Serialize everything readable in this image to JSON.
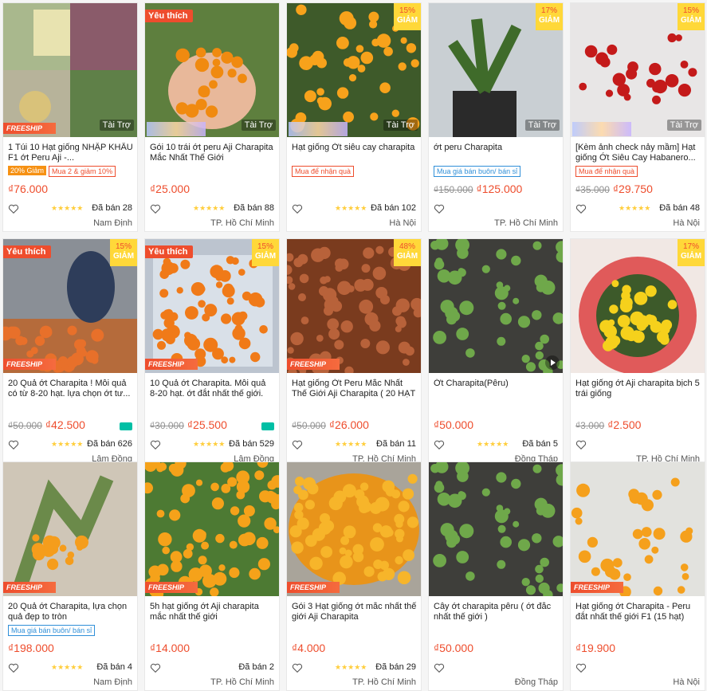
{
  "currency_symbol": "₫",
  "products": [
    {
      "title": "1 Túi 10 Hạt giống NHẬP KHẨU F1 ớt Peru Aji -...",
      "old_price": "",
      "price": "76.000",
      "sold": "Đã bán 28",
      "location": "Nam Định",
      "favorite_label": "",
      "discount": "",
      "freeship": "FREESHIP",
      "ad_label": "Tài Trợ",
      "tags": [
        {
          "type": "disc",
          "text": "20% Giảm"
        },
        {
          "type": "combo",
          "text": "Mua 2 & giảm 10%"
        }
      ],
      "stars": "★★★★★",
      "video": false,
      "photo": "collage"
    },
    {
      "title": "Gói 10 trái ớt peru Aji Charapita Mắc Nhất Thế Giới",
      "old_price": "",
      "price": "25.000",
      "sold": "Đã bán 88",
      "location": "TP. Hồ Chí Minh",
      "favorite_label": "Yêu thích",
      "discount": "",
      "freeship": "",
      "ad_label": "Tài Trợ",
      "tags": [],
      "stars": "★★★★★",
      "video": false,
      "photo": "hand"
    },
    {
      "title": "Hạt giống Ớt siêu cay charapita",
      "old_price": "",
      "price": "",
      "sold": "Đã bán 102",
      "location": "Hà Nội",
      "favorite_label": "",
      "discount": "15%",
      "freeship": "",
      "ad_label": "Tài Trợ",
      "tags": [
        {
          "type": "gift",
          "text": "Mua để nhận quà"
        }
      ],
      "stars": "★★★★★",
      "video": false,
      "photo": "orange"
    },
    {
      "title": "ớt peru Charapita",
      "old_price": "₫150.000",
      "price": "125.000",
      "sold": "",
      "location": "TP. Hồ Chí Minh",
      "favorite_label": "",
      "discount": "17%",
      "freeship": "",
      "ad_label": "Tài Trợ",
      "tags": [
        {
          "type": "whole",
          "text": "Mua giá bán buôn/ bán sỉ"
        }
      ],
      "stars": "",
      "video": false,
      "photo": "plant"
    },
    {
      "title": "[Kèm ảnh check nảy mầm] Hạt giống Ớt Siêu Cay Habanero...",
      "old_price": "₫35.000",
      "price": "29.750",
      "sold": "Đã bán 48",
      "location": "Hà Nội",
      "favorite_label": "",
      "discount": "15%",
      "freeship": "",
      "ad_label": "Tài Trợ",
      "tags": [
        {
          "type": "gift",
          "text": "Mua để nhận quà"
        }
      ],
      "stars": "★★★★★",
      "video": false,
      "photo": "red"
    },
    {
      "title": "20 Quả ớt Charapita ! Mỗi quả có từ 8-20 hạt. lựa chọn ớt tư...",
      "old_price": "₫50.000",
      "price": "42.500",
      "sold": "Đã bán 626",
      "location": "Lâm Đồng",
      "favorite_label": "Yêu thích",
      "discount": "15%",
      "freeship": "FREESHIP",
      "ad_label": "",
      "tags": [],
      "stars": "★★★★★",
      "video": false,
      "photo": "person",
      "ship_icon": true
    },
    {
      "title": "10 Quả ớt Charapita. Mỗi quả 8-20 hạt. ớt đắt nhất thế giới.",
      "old_price": "₫30.000",
      "price": "25.500",
      "sold": "Đã bán 529",
      "location": "Lâm Đồng",
      "favorite_label": "Yêu thích",
      "discount": "15%",
      "freeship": "FREESHIP",
      "ad_label": "",
      "tags": [],
      "stars": "★★★★★",
      "video": false,
      "photo": "bag",
      "ship_icon": true
    },
    {
      "title": "Hạt giống Ớt Peru Mắc Nhất Thế Giới Aji Charapita ( 20 HẠT",
      "old_price": "₫50.000",
      "price": "26.000",
      "sold": "Đã bán 11",
      "location": "TP. Hồ Chí Minh",
      "favorite_label": "",
      "discount": "48%",
      "freeship": "FREESHIP",
      "ad_label": "",
      "tags": [],
      "stars": "★★★★★",
      "video": false,
      "photo": "dried"
    },
    {
      "title": "Ớt Charapita(Pêru)",
      "old_price": "",
      "price": "50.000",
      "sold": "Đã bán 5",
      "location": "Đồng Tháp",
      "favorite_label": "",
      "discount": "",
      "freeship": "",
      "ad_label": "",
      "tags": [],
      "stars": "★★★★★",
      "video": true,
      "photo": "seedlings"
    },
    {
      "title": "Hạt giống ớt Aji charapita bịch 5 trái giống",
      "old_price": "₫3.000",
      "price": "2.500",
      "sold": "",
      "location": "TP. Hồ Chí Minh",
      "favorite_label": "",
      "discount": "17%",
      "freeship": "",
      "ad_label": "",
      "tags": [],
      "stars": "",
      "video": false,
      "photo": "basket"
    },
    {
      "title": "20 Quả ớt Charapita, lựa chọn quả đẹp to tròn",
      "old_price": "",
      "price": "198.000",
      "sold": "Đã bán 4",
      "location": "Nam Định",
      "favorite_label": "",
      "discount": "",
      "freeship": "FREESHIP",
      "ad_label": "",
      "tags": [
        {
          "type": "whole",
          "text": "Mua giá bán buôn/ bán sỉ"
        }
      ],
      "stars": "★★★★★",
      "video": false,
      "photo": "branch"
    },
    {
      "title": "5h hạt giống ớt Aji charapita mắc nhất thế giới",
      "old_price": "",
      "price": "14.000",
      "sold": "Đã bán 2",
      "location": "TP. Hồ Chí Minh",
      "favorite_label": "",
      "discount": "",
      "freeship": "FREESHIP",
      "ad_label": "",
      "tags": [],
      "stars": "",
      "video": false,
      "photo": "bush"
    },
    {
      "title": "Gói 3 Hạt giống ớt mắc nhất thế giới Aji Charapita",
      "old_price": "",
      "price": "4.000",
      "sold": "Đã bán 29",
      "location": "TP. Hồ Chí Minh",
      "favorite_label": "",
      "discount": "",
      "freeship": "FREESHIP",
      "ad_label": "",
      "tags": [],
      "stars": "★★★★★",
      "video": false,
      "photo": "pile"
    },
    {
      "title": "Cây ớt charapita pêru ( ớt đắc nhất thế giới )",
      "old_price": "",
      "price": "50.000",
      "sold": "",
      "location": "Đồng Tháp",
      "favorite_label": "",
      "discount": "",
      "freeship": "",
      "ad_label": "",
      "tags": [],
      "stars": "",
      "video": false,
      "photo": "seedlings"
    },
    {
      "title": "Hạt giống ớt Charapita - Peru đắt nhất thế giới F1 (15 hạt)",
      "old_price": "",
      "price": "19.900",
      "sold": "",
      "location": "Hà Nội",
      "favorite_label": "",
      "discount": "",
      "freeship": "FREESHIP",
      "ad_label": "",
      "tags": [],
      "stars": "",
      "video": false,
      "photo": "orange2"
    }
  ],
  "labels": {
    "discount_word": "GIẢM"
  },
  "colors": {
    "accent": "#ee4d2d",
    "star": "#ffce3d",
    "discount_badge": "#ffd839"
  }
}
